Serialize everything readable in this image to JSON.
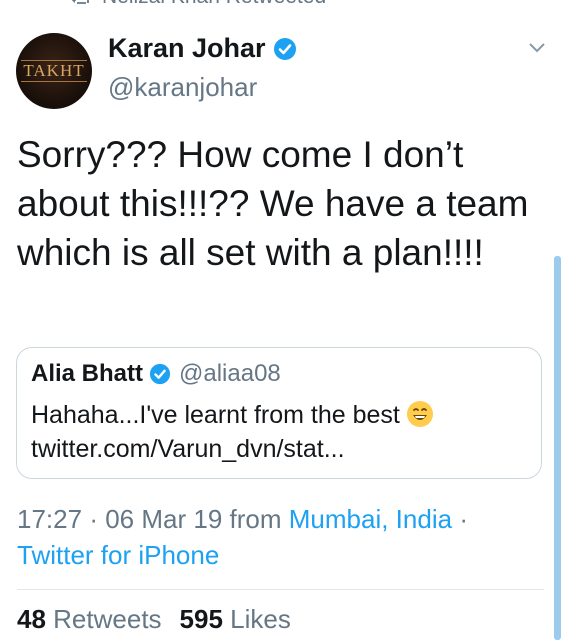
{
  "retweet": {
    "text": "Nelizai Khan Retweeted",
    "icon": "retweet-icon"
  },
  "author": {
    "avatar_text": "TAKHT",
    "display_name": "Karan Johar",
    "handle": "@karanjohar",
    "verified": true
  },
  "tweet": {
    "text": "Sorry??? How come I don’t about this!!!?? We have a team which is all set with a plan!!!!"
  },
  "quote": {
    "display_name": "Alia Bhatt",
    "handle": "@aliaa08",
    "verified": true,
    "line1": "Hahaha...I've learnt from the best",
    "line2": "twitter.com/Varun_dvn/stat..."
  },
  "meta": {
    "time": "17:27",
    "separator": "·",
    "date": "06 Mar 19",
    "from": "from",
    "location": "Mumbai, India",
    "client": "Twitter for iPhone"
  },
  "stats": {
    "retweets_count": "48",
    "retweets_label": "Retweets",
    "likes_count": "595",
    "likes_label": "Likes"
  },
  "colors": {
    "accent": "#1da1f2",
    "secondary_text": "#657786",
    "border": "#ccd6dd"
  }
}
